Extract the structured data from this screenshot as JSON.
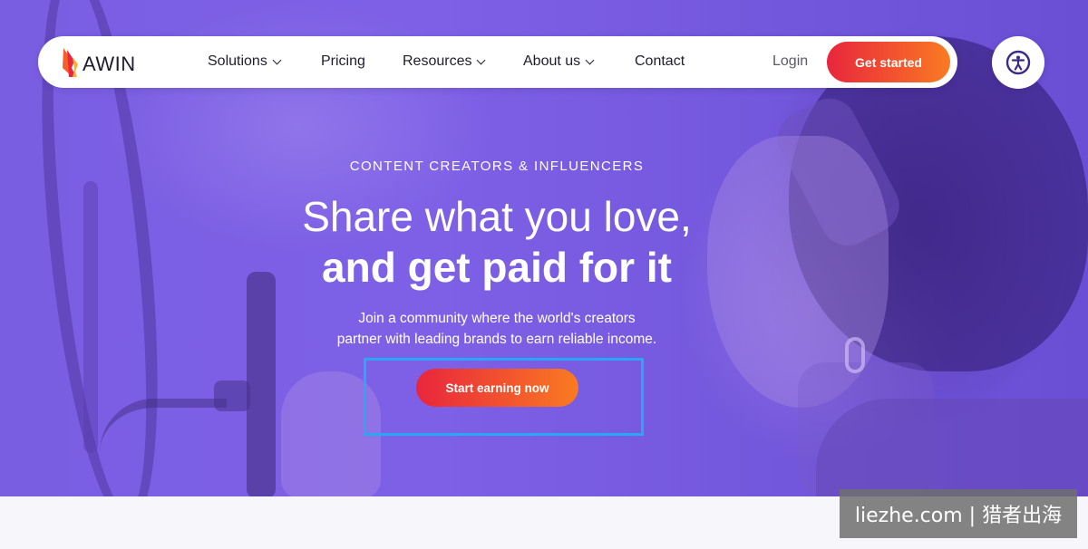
{
  "brand": {
    "name": "AWIN"
  },
  "nav": {
    "items": [
      {
        "label": "Solutions",
        "has_dropdown": true
      },
      {
        "label": "Pricing",
        "has_dropdown": false
      },
      {
        "label": "Resources",
        "has_dropdown": true
      },
      {
        "label": "About us",
        "has_dropdown": true
      },
      {
        "label": "Contact",
        "has_dropdown": false
      }
    ],
    "login_label": "Login",
    "cta_label": "Get started"
  },
  "accessibility": {
    "icon": "accessibility-icon"
  },
  "hero": {
    "eyebrow": "CONTENT CREATORS & INFLUENCERS",
    "headline_line1": "Share what you love,",
    "headline_line2": "and get paid for it",
    "subtext_line1": "Join a community where the world's creators",
    "subtext_line2": "partner with leading brands to earn reliable income.",
    "cta_label": "Start earning now"
  },
  "watermark": {
    "text": "liezhe.com | 猎者出海"
  },
  "colors": {
    "hero_purple": "#7a5ee2",
    "cta_gradient_start": "#e8263d",
    "cta_gradient_end": "#f97b22",
    "highlight_blue": "#2ba6f4"
  }
}
